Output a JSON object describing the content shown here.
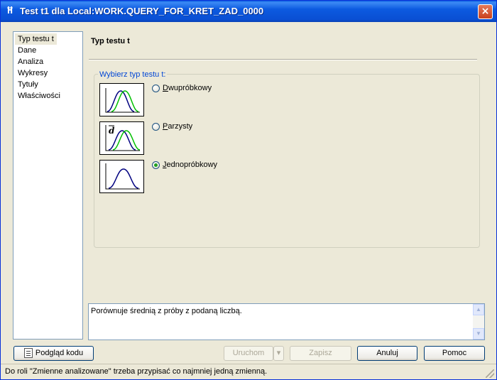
{
  "window": {
    "title": "Test t1 dla Local:WORK.QUERY_FOR_KRET_ZAD_0000",
    "app_icon": "Ħ",
    "close_glyph": "×"
  },
  "nav": {
    "items": [
      "Typ testu t",
      "Dane",
      "Analiza",
      "Wykresy",
      "Tytuły",
      "Właściwości"
    ],
    "selected": "Typ testu t"
  },
  "main": {
    "page_title": "Typ testu t",
    "group_label": "Wybierz typ testu t:",
    "options": [
      {
        "label": "Dwupróbkowy",
        "checked": false,
        "icon": "two-sample-distribution-icon"
      },
      {
        "label": "Parzysty",
        "checked": false,
        "icon": "paired-difference-distribution-icon",
        "symbol": "d"
      },
      {
        "label": "Jednopróbkowy",
        "checked": true,
        "icon": "one-sample-distribution-icon"
      }
    ],
    "description": "Porównuje średnią z próby z podaną liczbą."
  },
  "buttons": {
    "code_preview": "Podgląd kodu",
    "run": "Uruchom",
    "run_dropdown": "▾",
    "save": "Zapisz",
    "cancel": "Anuluj",
    "help": "Pomoc"
  },
  "status": {
    "text": "Do roli \"Zmienne analizowane\" trzeba przypisać co najmniej jedną zmienną."
  },
  "colors": {
    "title_bar": "#0a5ddf",
    "dialog_bg": "#ece9d8",
    "group_label": "#0046d5",
    "curve_blue": "#000080",
    "curve_green": "#00c000"
  }
}
